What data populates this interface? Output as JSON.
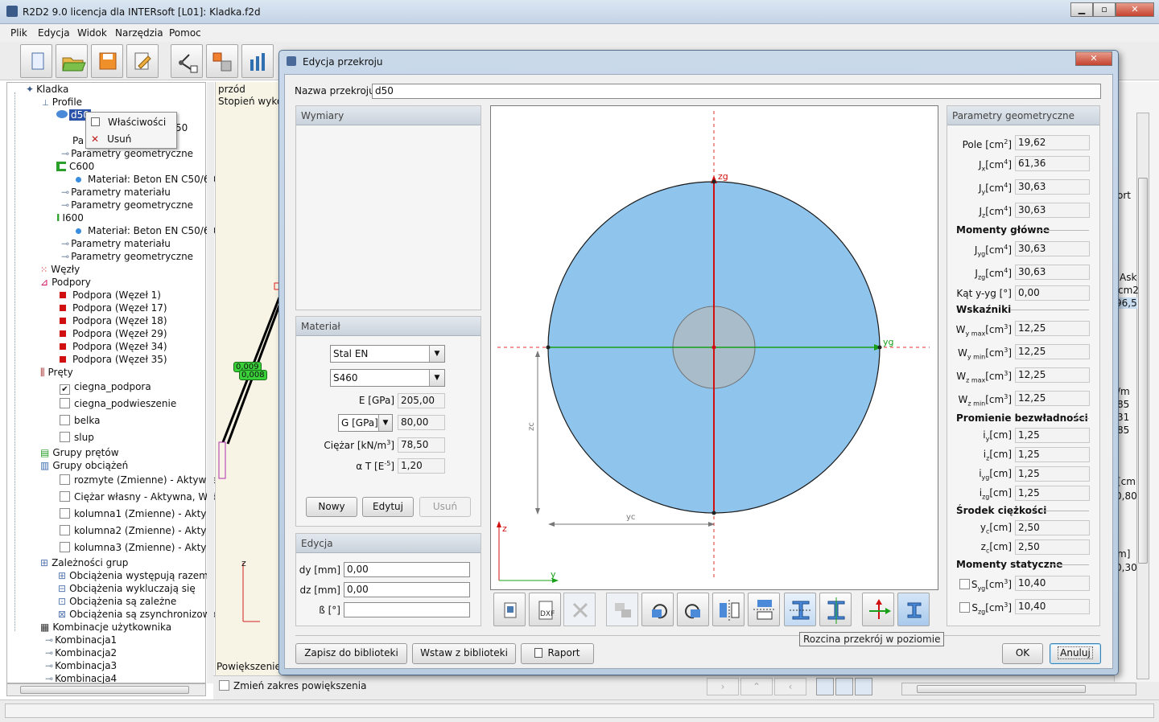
{
  "app": {
    "title": "R2D2 9.0 licencja dla INTERsoft [L01]: Kladka.f2d",
    "menu": [
      "Plik",
      "Edycja",
      "Widok",
      "Narzędzia",
      "Pomoc"
    ]
  },
  "tree": {
    "root": "Kladka",
    "profile": "Profile",
    "d50": "d50",
    "d50_partial": "Pa",
    "d50_tail": "50",
    "params_geo": "Parametry geometryczne",
    "params_mat": "Parametry materiału",
    "c600": "C600",
    "i600": "I600",
    "mat_beton": "Materiał: Beton EN C50/60",
    "wezly": "Węzły",
    "podpory": "Podpory",
    "podpora_items": [
      "Podpora (Węzeł 1)",
      "Podpora (Węzeł 17)",
      "Podpora (Węzeł 18)",
      "Podpora (Węzeł 29)",
      "Podpora (Węzeł 34)",
      "Podpora (Węzeł 35)"
    ],
    "prety": "Pręty",
    "pret_items": [
      "ciegna_podpora",
      "ciegna_podwieszenie",
      "belka",
      "slup"
    ],
    "grupy_pretow": "Grupy prętów",
    "grupy_obciazen": "Grupy obciążeń",
    "obciazen_items": [
      "rozmyte (Zmienne) - Aktywna,",
      "Ciężar własny - Aktywna, Wido",
      "kolumna1 (Zmienne) - Aktywn",
      "kolumna2 (Zmienne) - Aktywn",
      "kolumna3 (Zmienne) - Aktywn"
    ],
    "zaleznosci": "Zależności grup",
    "zaleznosci_items": [
      "Obciążenia występują razem",
      "Obciążenia wykluczają się",
      "Obciążenia są zależne",
      "Obciążenia są zsynchronizowa"
    ],
    "kombinacje": "Kombinacje użytkownika",
    "kombinacje_items": [
      "Kombinacja1",
      "Kombinacja2",
      "Kombinacja3",
      "Kombinacja4"
    ]
  },
  "context_menu": {
    "properties": "Właściwości",
    "delete": "Usuń"
  },
  "background": {
    "view_label": "przód",
    "stage_label": "Stopień wykor",
    "tag1": "0,009",
    "tag2": "0,008",
    "axis_z": "z",
    "zoom_label": "Powiększenie",
    "zoom_check": "Zmień zakres powiększenia",
    "right_frags": [
      "ort",
      "Ask",
      "cm2",
      "96,5",
      "/m",
      "85",
      "31",
      "85",
      "[cm",
      "0,80",
      "m]",
      "0,30"
    ]
  },
  "dialog": {
    "title": "Edycja przekroju",
    "name_label": "Nazwa przekroju",
    "name_value": "d50",
    "wymiary_title": "Wymiary",
    "material_title": "Materiał",
    "material_standard": "Stal EN",
    "material_grade": "S460",
    "e_label": "E [GPa]",
    "e_value": "205,00",
    "g_label": "G [GPa]",
    "g_value": "80,00",
    "ciezar_label": "Ciężar [kN/m",
    "ciezar_sup": "3",
    "ciezar_value": "78,50",
    "alpha_label": "α T [E",
    "alpha_sup": "-5",
    "alpha_value": "1,20",
    "btn_new": "Nowy",
    "btn_edit": "Edytuj",
    "btn_delete": "Usuń",
    "edycja_title": "Edycja",
    "dy_label": "dy [mm]",
    "dy_value": "0,00",
    "dz_label": "dz [mm]",
    "dz_value": "0,00",
    "beta_label": "ß [°]",
    "beta_value": "",
    "btn_save_lib": "Zapisz do biblioteki",
    "btn_insert_lib": "Wstaw z biblioteki",
    "btn_report": "Raport",
    "btn_ok": "OK",
    "btn_cancel": "Anuluj",
    "tooltip": "Rozcina przekrój w poziomie"
  },
  "drawing": {
    "zg": "zg",
    "yg": "yg",
    "zc": "zc",
    "yc": "yc",
    "z": "z",
    "y": "y",
    "fill_color": "#8fc4ec"
  },
  "geo": {
    "title": "Parametry geometryczne",
    "pole_value": "19,62",
    "jx_value": "61,36",
    "jy_value": "30,63",
    "jz_value": "30,63",
    "momenty_glowne": "Momenty główne",
    "jyg_value": "30,63",
    "jzg_value": "30,63",
    "kat_label": "Kąt y-yg [°]",
    "kat_value": "0,00",
    "wskazniki": "Wskaźniki",
    "wymax_value": "12,25",
    "wymin_value": "12,25",
    "wzmax_value": "12,25",
    "wzmin_value": "12,25",
    "promienie": "Promienie bezwładności",
    "iy_value": "1,25",
    "iz_value": "1,25",
    "iyg_value": "1,25",
    "izg_value": "1,25",
    "srodek": "Środek ciężkości",
    "yc_value": "2,50",
    "zc_value": "2,50",
    "momenty_stat": "Momenty statyczne",
    "syg_value": "10,40",
    "szg_value": "10,40"
  }
}
